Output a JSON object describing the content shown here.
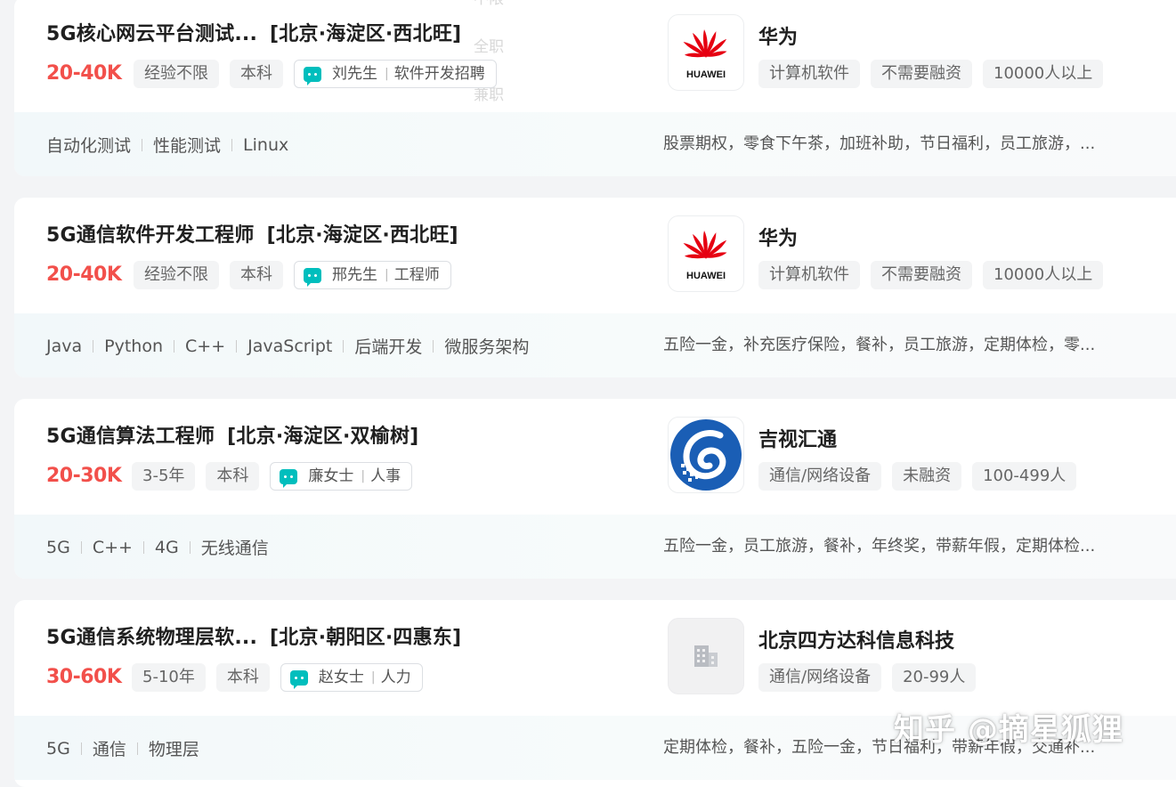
{
  "ghost_menu": {
    "item1": "不限",
    "item2": "全职",
    "item3": "兼职"
  },
  "jobs": [
    {
      "title": "5G核心网云平台测试...",
      "location": "[北京·海淀区·西北旺]",
      "salary": "20-40K",
      "experience": "经验不限",
      "degree": "本科",
      "recruiter_name": "刘先生",
      "recruiter_role": "软件开发招聘",
      "skills": [
        "自动化测试",
        "性能测试",
        "Linux"
      ],
      "company": "华为",
      "company_tags": [
        "计算机软件",
        "不需要融资",
        "10000人以上"
      ],
      "benefits": "股票期权，零食下午茶，加班补助，节日福利，员工旅游，...",
      "logo": "huawei-logo",
      "logo_text": "HUAWEI"
    },
    {
      "title": "5G通信软件开发工程师",
      "location": "[北京·海淀区·西北旺]",
      "salary": "20-40K",
      "experience": "经验不限",
      "degree": "本科",
      "recruiter_name": "邢先生",
      "recruiter_role": "工程师",
      "skills": [
        "Java",
        "Python",
        "C++",
        "JavaScript",
        "后端开发",
        "微服务架构"
      ],
      "company": "华为",
      "company_tags": [
        "计算机软件",
        "不需要融资",
        "10000人以上"
      ],
      "benefits": "五险一金，补充医疗保险，餐补，员工旅游，定期体检，零...",
      "logo": "huawei-logo",
      "logo_text": "HUAWEI"
    },
    {
      "title": "5G通信算法工程师",
      "location": "[北京·海淀区·双榆树]",
      "salary": "20-30K",
      "experience": "3-5年",
      "degree": "本科",
      "recruiter_name": "廉女士",
      "recruiter_role": "人事",
      "skills": [
        "5G",
        "C++",
        "4G",
        "无线通信"
      ],
      "company": "吉视汇通",
      "company_tags": [
        "通信/网络设备",
        "未融资",
        "100-499人"
      ],
      "benefits": "五险一金，员工旅游，餐补，年终奖，带薪年假，定期体检...",
      "logo": "jishi-logo"
    },
    {
      "title": "5G通信系统物理层软...",
      "location": "[北京·朝阳区·四惠东]",
      "salary": "30-60K",
      "experience": "5-10年",
      "degree": "本科",
      "recruiter_name": "赵女士",
      "recruiter_role": "人力",
      "skills": [
        "5G",
        "通信",
        "物理层"
      ],
      "company": "北京四方达科信息科技",
      "company_tags": [
        "通信/网络设备",
        "20-99人"
      ],
      "benefits": "定期体检，餐补，五险一金，节日福利，带薪年假，交通补...",
      "logo": "building-logo"
    }
  ],
  "watermark": "知乎 @摘星狐狸",
  "colors": {
    "salary": "#f2504b",
    "chat": "#00bebd",
    "huawei_red": "#e60012",
    "jishi_blue": "#1a5eb5"
  }
}
